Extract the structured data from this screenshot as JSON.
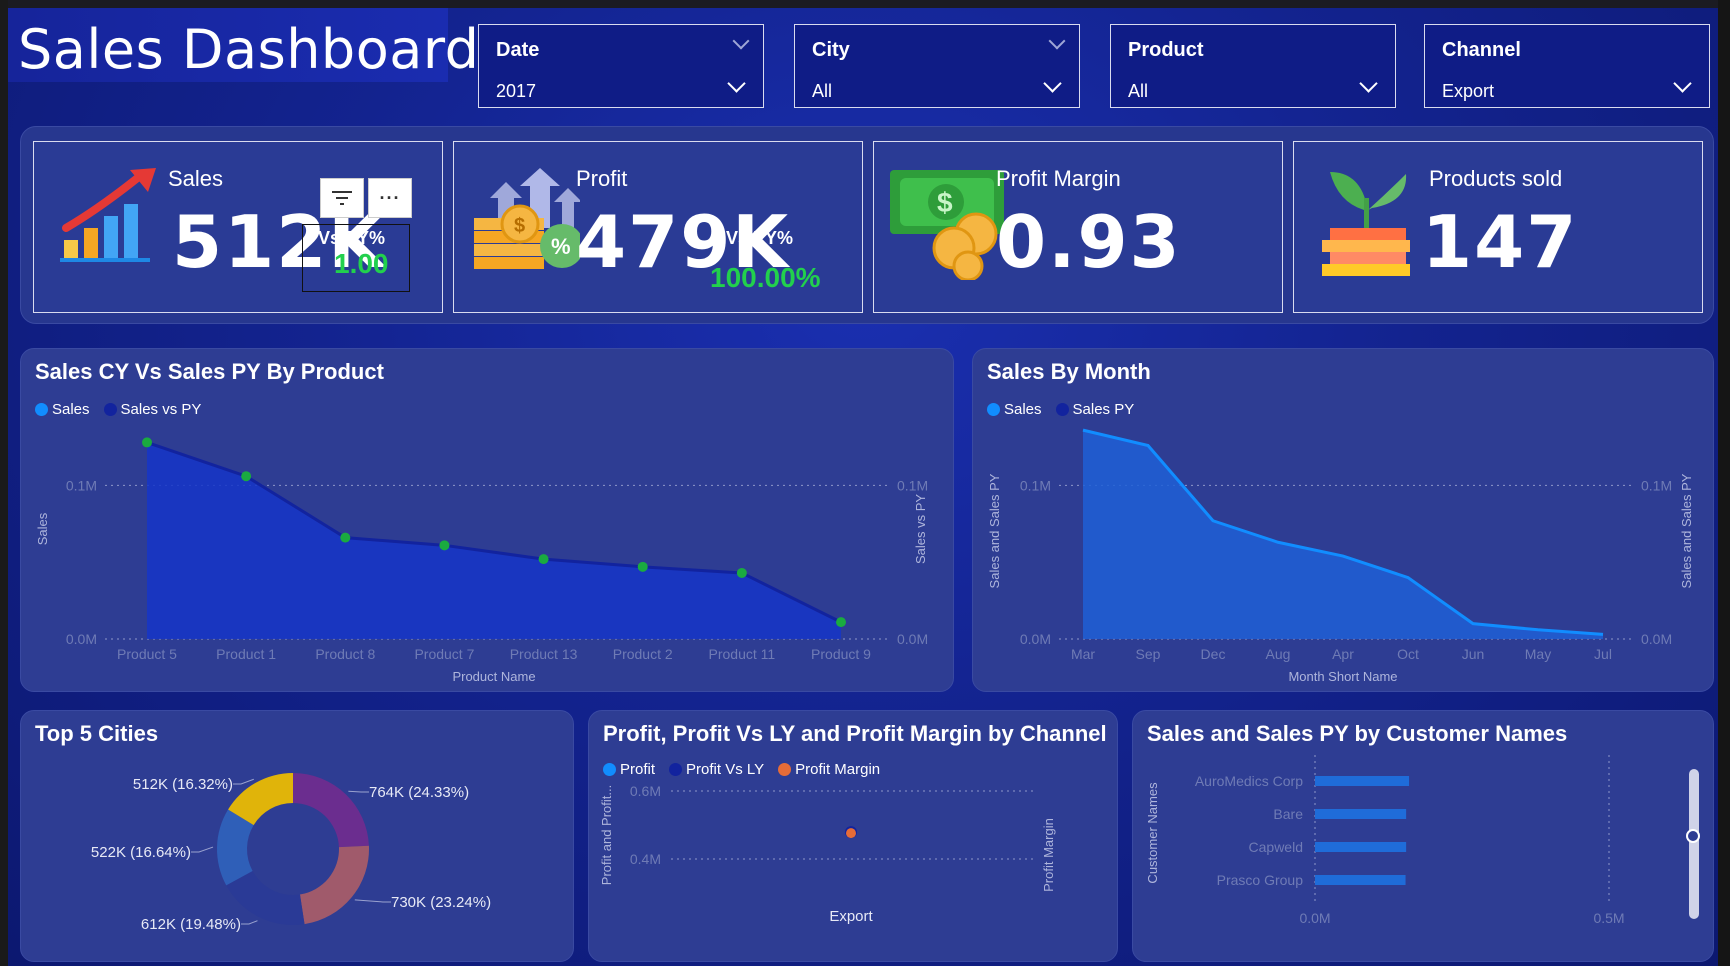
{
  "title": "Sales Dashboard",
  "slicers": [
    {
      "label": "Date",
      "value": "2017"
    },
    {
      "label": "City",
      "value": "All"
    },
    {
      "label": "Product",
      "value": "All"
    },
    {
      "label": "Channel",
      "value": "Export"
    }
  ],
  "kpis": {
    "sales": {
      "title": "Sales",
      "value": "512K",
      "vs_label": "Vs PY%",
      "vs_value": "1.00"
    },
    "profit": {
      "title": "Profit",
      "value": "479K",
      "vs_label": "Vs PY%",
      "vs_value": "100.00%"
    },
    "margin": {
      "title": "Profit Margin",
      "value": "0.93"
    },
    "products": {
      "title": "Products sold",
      "value": "147"
    }
  },
  "colors": {
    "accent_blue": "#118dff",
    "dark_blue": "#12239e",
    "orange": "#e66c37",
    "green_marker": "#1aab40",
    "positive": "#22d04d"
  },
  "chart_data": [
    {
      "type": "area",
      "title": "Sales CY Vs Sales PY By Product",
      "legend": [
        "Sales",
        "Sales vs PY"
      ],
      "xlabel": "Product Name",
      "ylabel": "Sales",
      "ylabel_right": "Sales vs PY",
      "yticks": [
        "0.0M",
        "0.1M"
      ],
      "yticks_right": [
        "0.0M",
        "0.1M"
      ],
      "ylim": [
        0,
        0.14
      ],
      "categories": [
        "Product 5",
        "Product 1",
        "Product 8",
        "Product 7",
        "Product 13",
        "Product 2",
        "Product 11",
        "Product 9"
      ],
      "series": [
        {
          "name": "Sales",
          "values": [
            0.128,
            0.106,
            0.066,
            0.061,
            0.052,
            0.047,
            0.043,
            0.011
          ]
        }
      ]
    },
    {
      "type": "area",
      "title": "Sales By Month",
      "legend": [
        "Sales",
        "Sales PY"
      ],
      "xlabel": "Month Short Name",
      "ylabel": "Sales and Sales PY",
      "ylabel_right": "Sales and Sales PY",
      "yticks": [
        "0.0M",
        "0.1M"
      ],
      "yticks_right": [
        "0.0M",
        "0.1M"
      ],
      "ylim": [
        0,
        0.14
      ],
      "categories": [
        "Mar",
        "Sep",
        "Dec",
        "Aug",
        "Apr",
        "Oct",
        "Jun",
        "May",
        "Jul"
      ],
      "series": [
        {
          "name": "Sales",
          "values": [
            0.136,
            0.126,
            0.077,
            0.063,
            0.054,
            0.04,
            0.01,
            0.006,
            0.003
          ]
        }
      ]
    },
    {
      "type": "pie",
      "title": "Top 5 Cities",
      "labels": [
        "764K (24.33%)",
        "730K (23.24%)",
        "612K (19.48%)",
        "522K (16.64%)",
        "512K (16.32%)"
      ],
      "values": [
        764,
        730,
        612,
        522,
        512
      ],
      "colors": [
        "#6b2d8f",
        "#a05a6b",
        "#2a3a96",
        "#2f5fb8",
        "#e0b40a"
      ]
    },
    {
      "type": "scatter",
      "title": "Profit, Profit Vs LY and Profit Margin by Channel",
      "legend": [
        "Profit",
        "Profit Vs LY",
        "Profit Margin"
      ],
      "ylabel": "Profit and Profit...",
      "ylabel_right": "Profit Margin",
      "yticks": [
        "0.4M",
        "0.6M"
      ],
      "categories": [
        "Export"
      ],
      "series": [
        {
          "name": "Profit",
          "values": [
            0.479
          ]
        },
        {
          "name": "Profit Vs LY",
          "values": [
            0.479
          ]
        },
        {
          "name": "Profit Margin",
          "values": [
            0.93
          ]
        }
      ]
    },
    {
      "type": "bar",
      "title": "Sales and Sales PY by Customer Names",
      "ylabel": "Customer Names",
      "xticks": [
        "0.0M",
        "0.5M"
      ],
      "xlim": [
        0,
        0.5
      ],
      "categories": [
        "AuroMedics Corp",
        "Bare",
        "Capweld",
        "Prasco Group"
      ],
      "series": [
        {
          "name": "Sales",
          "values": [
            0.16,
            0.155,
            0.155,
            0.154
          ]
        }
      ]
    }
  ]
}
